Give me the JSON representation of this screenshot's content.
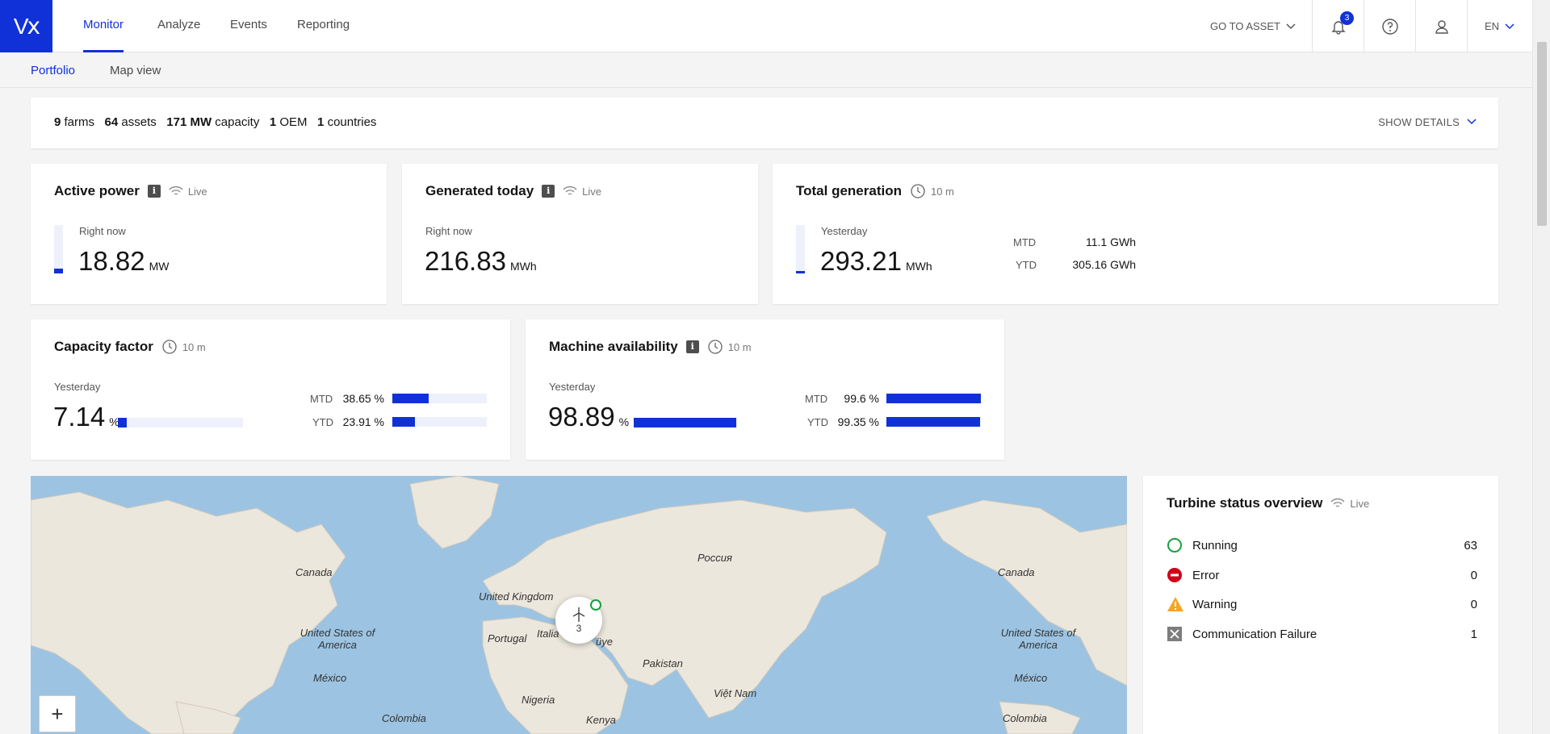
{
  "header": {
    "logo": "Vⅹ",
    "nav": [
      "Monitor",
      "Analyze",
      "Events",
      "Reporting"
    ],
    "go_to_asset": "GO TO ASSET",
    "notifications_count": "3",
    "language": "EN"
  },
  "subnav": {
    "tabs": [
      "Portfolio",
      "Map view"
    ]
  },
  "summary": {
    "farms_value": "9",
    "farms_label": "farms",
    "assets_value": "64",
    "assets_label": "assets",
    "capacity_value": "171 MW",
    "capacity_label": "capacity",
    "oem_value": "1",
    "oem_label": "OEM",
    "countries_value": "1",
    "countries_label": "countries",
    "show_details": "SHOW DETAILS"
  },
  "active_power": {
    "title": "Active power",
    "status": "Live",
    "label": "Right now",
    "value": "18.82",
    "unit": "MW",
    "level": 0.1
  },
  "generated_today": {
    "title": "Generated today",
    "status": "Live",
    "label": "Right now",
    "value": "216.83",
    "unit": "MWh"
  },
  "total_generation": {
    "title": "Total generation",
    "refresh": "10 m",
    "label": "Yesterday",
    "value": "293.21",
    "unit": "MWh",
    "level": 0.05,
    "mtd_label": "MTD",
    "mtd_value": "11.1 GWh",
    "ytd_label": "YTD",
    "ytd_value": "305.16 GWh"
  },
  "capacity_factor": {
    "title": "Capacity factor",
    "refresh": "10 m",
    "label": "Yesterday",
    "value": "7.14",
    "unit": "%",
    "mtd_label": "MTD",
    "mtd_value": "38.65 %",
    "ytd_label": "YTD",
    "ytd_value": "23.91 %",
    "levels": {
      "yesterday": 7.14,
      "mtd": 38.65,
      "ytd": 23.91
    }
  },
  "machine_availability": {
    "title": "Machine availability",
    "refresh": "10 m",
    "label": "Yesterday",
    "value": "98.89",
    "unit": "%",
    "mtd_label": "MTD",
    "mtd_value": "99.6 %",
    "ytd_label": "YTD",
    "ytd_value": "99.35 %",
    "levels": {
      "yesterday": 98.89,
      "mtd": 99.6,
      "ytd": 99.35
    }
  },
  "map": {
    "labels": [
      "Canada",
      "Россия",
      "Canada",
      "United Kingdom",
      "United States of America",
      "United States of America",
      "Portugal",
      "Italia",
      "üye",
      "Pakistan",
      "México",
      "México",
      "Nigeria",
      "Việt Nam",
      "Colombia",
      "Kenya",
      "Colombia"
    ],
    "cluster_count": "3",
    "zoom_in": "+"
  },
  "turbine_status": {
    "title": "Turbine status overview",
    "status": "Live",
    "rows": [
      {
        "label": "Running",
        "count": "63"
      },
      {
        "label": "Error",
        "count": "0"
      },
      {
        "label": "Warning",
        "count": "0"
      },
      {
        "label": "Communication Failure",
        "count": "1"
      }
    ]
  },
  "colors": {
    "accent": "#1131d8",
    "running": "#1a9e3e",
    "error": "#d0021b",
    "warning": "#f5a623",
    "comm_failure": "#7d7d7d"
  }
}
